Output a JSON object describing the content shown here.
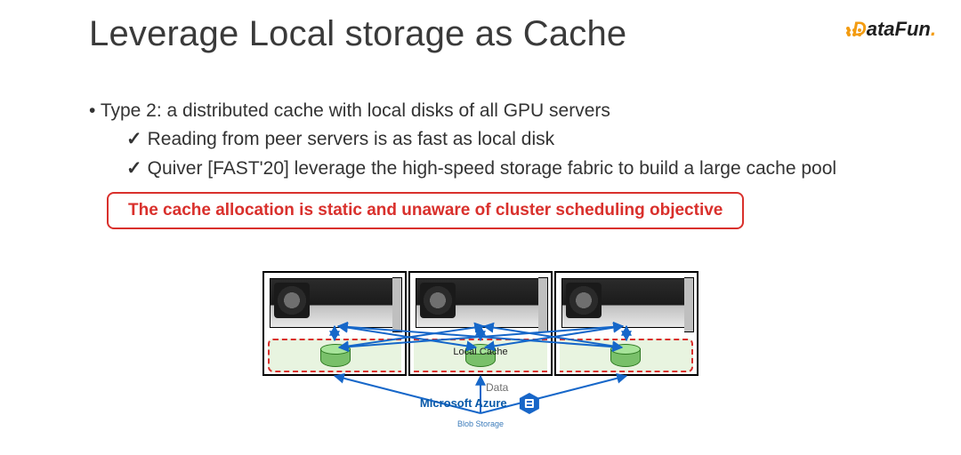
{
  "title": "Leverage Local storage as Cache",
  "logo": {
    "brand_d": "D",
    "brand_rest": "ataFun",
    "brand_dot": "."
  },
  "bullets": {
    "main": "Type 2: a distributed cache with local disks of all GPU servers",
    "sub1": "Reading from peer servers is as fast as local disk",
    "sub2": "Quiver [FAST'20] leverage the high-speed storage fabric to build a large cache pool"
  },
  "callout": "The cache allocation is static and unaware of cluster scheduling objective",
  "diagram": {
    "cache_label": "Local Cache",
    "data_label": "Data",
    "blob_line1": "Microsoft Azure",
    "blob_line2": "Blob Storage"
  }
}
